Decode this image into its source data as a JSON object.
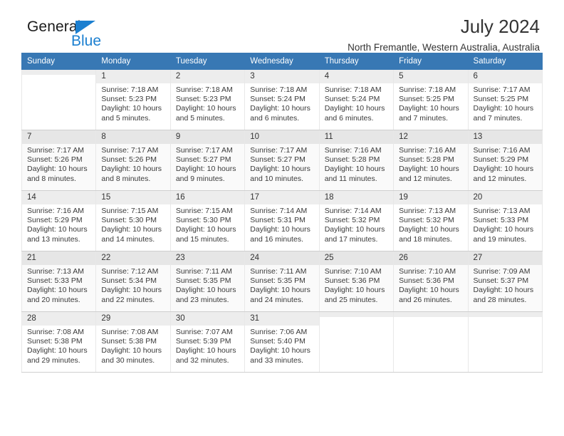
{
  "brand": {
    "name_top": "General",
    "name_bottom": "Blue",
    "triangle_icon": "triangle-icon",
    "accent_color": "#1b7fd0"
  },
  "header": {
    "title": "July 2024",
    "subtitle": "North Fremantle, Western Australia, Australia"
  },
  "calendar": {
    "header_bg": "#3878b4",
    "header_text_color": "#ffffff",
    "weekday_headers": [
      "Sunday",
      "Monday",
      "Tuesday",
      "Wednesday",
      "Thursday",
      "Friday",
      "Saturday"
    ],
    "labels": {
      "sunrise": "Sunrise:",
      "sunset": "Sunset:",
      "daylight": "Daylight:"
    },
    "weeks": [
      [
        {
          "day": "",
          "sunrise": "",
          "sunset": "",
          "daylight_line1": "",
          "daylight_line2": ""
        },
        {
          "day": "1",
          "sunrise": "Sunrise: 7:18 AM",
          "sunset": "Sunset: 5:23 PM",
          "daylight_line1": "Daylight: 10 hours",
          "daylight_line2": "and 5 minutes."
        },
        {
          "day": "2",
          "sunrise": "Sunrise: 7:18 AM",
          "sunset": "Sunset: 5:23 PM",
          "daylight_line1": "Daylight: 10 hours",
          "daylight_line2": "and 5 minutes."
        },
        {
          "day": "3",
          "sunrise": "Sunrise: 7:18 AM",
          "sunset": "Sunset: 5:24 PM",
          "daylight_line1": "Daylight: 10 hours",
          "daylight_line2": "and 6 minutes."
        },
        {
          "day": "4",
          "sunrise": "Sunrise: 7:18 AM",
          "sunset": "Sunset: 5:24 PM",
          "daylight_line1": "Daylight: 10 hours",
          "daylight_line2": "and 6 minutes."
        },
        {
          "day": "5",
          "sunrise": "Sunrise: 7:18 AM",
          "sunset": "Sunset: 5:25 PM",
          "daylight_line1": "Daylight: 10 hours",
          "daylight_line2": "and 7 minutes."
        },
        {
          "day": "6",
          "sunrise": "Sunrise: 7:17 AM",
          "sunset": "Sunset: 5:25 PM",
          "daylight_line1": "Daylight: 10 hours",
          "daylight_line2": "and 7 minutes."
        }
      ],
      [
        {
          "day": "7",
          "sunrise": "Sunrise: 7:17 AM",
          "sunset": "Sunset: 5:26 PM",
          "daylight_line1": "Daylight: 10 hours",
          "daylight_line2": "and 8 minutes."
        },
        {
          "day": "8",
          "sunrise": "Sunrise: 7:17 AM",
          "sunset": "Sunset: 5:26 PM",
          "daylight_line1": "Daylight: 10 hours",
          "daylight_line2": "and 8 minutes."
        },
        {
          "day": "9",
          "sunrise": "Sunrise: 7:17 AM",
          "sunset": "Sunset: 5:27 PM",
          "daylight_line1": "Daylight: 10 hours",
          "daylight_line2": "and 9 minutes."
        },
        {
          "day": "10",
          "sunrise": "Sunrise: 7:17 AM",
          "sunset": "Sunset: 5:27 PM",
          "daylight_line1": "Daylight: 10 hours",
          "daylight_line2": "and 10 minutes."
        },
        {
          "day": "11",
          "sunrise": "Sunrise: 7:16 AM",
          "sunset": "Sunset: 5:28 PM",
          "daylight_line1": "Daylight: 10 hours",
          "daylight_line2": "and 11 minutes."
        },
        {
          "day": "12",
          "sunrise": "Sunrise: 7:16 AM",
          "sunset": "Sunset: 5:28 PM",
          "daylight_line1": "Daylight: 10 hours",
          "daylight_line2": "and 12 minutes."
        },
        {
          "day": "13",
          "sunrise": "Sunrise: 7:16 AM",
          "sunset": "Sunset: 5:29 PM",
          "daylight_line1": "Daylight: 10 hours",
          "daylight_line2": "and 12 minutes."
        }
      ],
      [
        {
          "day": "14",
          "sunrise": "Sunrise: 7:16 AM",
          "sunset": "Sunset: 5:29 PM",
          "daylight_line1": "Daylight: 10 hours",
          "daylight_line2": "and 13 minutes."
        },
        {
          "day": "15",
          "sunrise": "Sunrise: 7:15 AM",
          "sunset": "Sunset: 5:30 PM",
          "daylight_line1": "Daylight: 10 hours",
          "daylight_line2": "and 14 minutes."
        },
        {
          "day": "16",
          "sunrise": "Sunrise: 7:15 AM",
          "sunset": "Sunset: 5:30 PM",
          "daylight_line1": "Daylight: 10 hours",
          "daylight_line2": "and 15 minutes."
        },
        {
          "day": "17",
          "sunrise": "Sunrise: 7:14 AM",
          "sunset": "Sunset: 5:31 PM",
          "daylight_line1": "Daylight: 10 hours",
          "daylight_line2": "and 16 minutes."
        },
        {
          "day": "18",
          "sunrise": "Sunrise: 7:14 AM",
          "sunset": "Sunset: 5:32 PM",
          "daylight_line1": "Daylight: 10 hours",
          "daylight_line2": "and 17 minutes."
        },
        {
          "day": "19",
          "sunrise": "Sunrise: 7:13 AM",
          "sunset": "Sunset: 5:32 PM",
          "daylight_line1": "Daylight: 10 hours",
          "daylight_line2": "and 18 minutes."
        },
        {
          "day": "20",
          "sunrise": "Sunrise: 7:13 AM",
          "sunset": "Sunset: 5:33 PM",
          "daylight_line1": "Daylight: 10 hours",
          "daylight_line2": "and 19 minutes."
        }
      ],
      [
        {
          "day": "21",
          "sunrise": "Sunrise: 7:13 AM",
          "sunset": "Sunset: 5:33 PM",
          "daylight_line1": "Daylight: 10 hours",
          "daylight_line2": "and 20 minutes."
        },
        {
          "day": "22",
          "sunrise": "Sunrise: 7:12 AM",
          "sunset": "Sunset: 5:34 PM",
          "daylight_line1": "Daylight: 10 hours",
          "daylight_line2": "and 22 minutes."
        },
        {
          "day": "23",
          "sunrise": "Sunrise: 7:11 AM",
          "sunset": "Sunset: 5:35 PM",
          "daylight_line1": "Daylight: 10 hours",
          "daylight_line2": "and 23 minutes."
        },
        {
          "day": "24",
          "sunrise": "Sunrise: 7:11 AM",
          "sunset": "Sunset: 5:35 PM",
          "daylight_line1": "Daylight: 10 hours",
          "daylight_line2": "and 24 minutes."
        },
        {
          "day": "25",
          "sunrise": "Sunrise: 7:10 AM",
          "sunset": "Sunset: 5:36 PM",
          "daylight_line1": "Daylight: 10 hours",
          "daylight_line2": "and 25 minutes."
        },
        {
          "day": "26",
          "sunrise": "Sunrise: 7:10 AM",
          "sunset": "Sunset: 5:36 PM",
          "daylight_line1": "Daylight: 10 hours",
          "daylight_line2": "and 26 minutes."
        },
        {
          "day": "27",
          "sunrise": "Sunrise: 7:09 AM",
          "sunset": "Sunset: 5:37 PM",
          "daylight_line1": "Daylight: 10 hours",
          "daylight_line2": "and 28 minutes."
        }
      ],
      [
        {
          "day": "28",
          "sunrise": "Sunrise: 7:08 AM",
          "sunset": "Sunset: 5:38 PM",
          "daylight_line1": "Daylight: 10 hours",
          "daylight_line2": "and 29 minutes."
        },
        {
          "day": "29",
          "sunrise": "Sunrise: 7:08 AM",
          "sunset": "Sunset: 5:38 PM",
          "daylight_line1": "Daylight: 10 hours",
          "daylight_line2": "and 30 minutes."
        },
        {
          "day": "30",
          "sunrise": "Sunrise: 7:07 AM",
          "sunset": "Sunset: 5:39 PM",
          "daylight_line1": "Daylight: 10 hours",
          "daylight_line2": "and 32 minutes."
        },
        {
          "day": "31",
          "sunrise": "Sunrise: 7:06 AM",
          "sunset": "Sunset: 5:40 PM",
          "daylight_line1": "Daylight: 10 hours",
          "daylight_line2": "and 33 minutes."
        },
        {
          "day": "",
          "sunrise": "",
          "sunset": "",
          "daylight_line1": "",
          "daylight_line2": ""
        },
        {
          "day": "",
          "sunrise": "",
          "sunset": "",
          "daylight_line1": "",
          "daylight_line2": ""
        },
        {
          "day": "",
          "sunrise": "",
          "sunset": "",
          "daylight_line1": "",
          "daylight_line2": ""
        }
      ]
    ]
  }
}
